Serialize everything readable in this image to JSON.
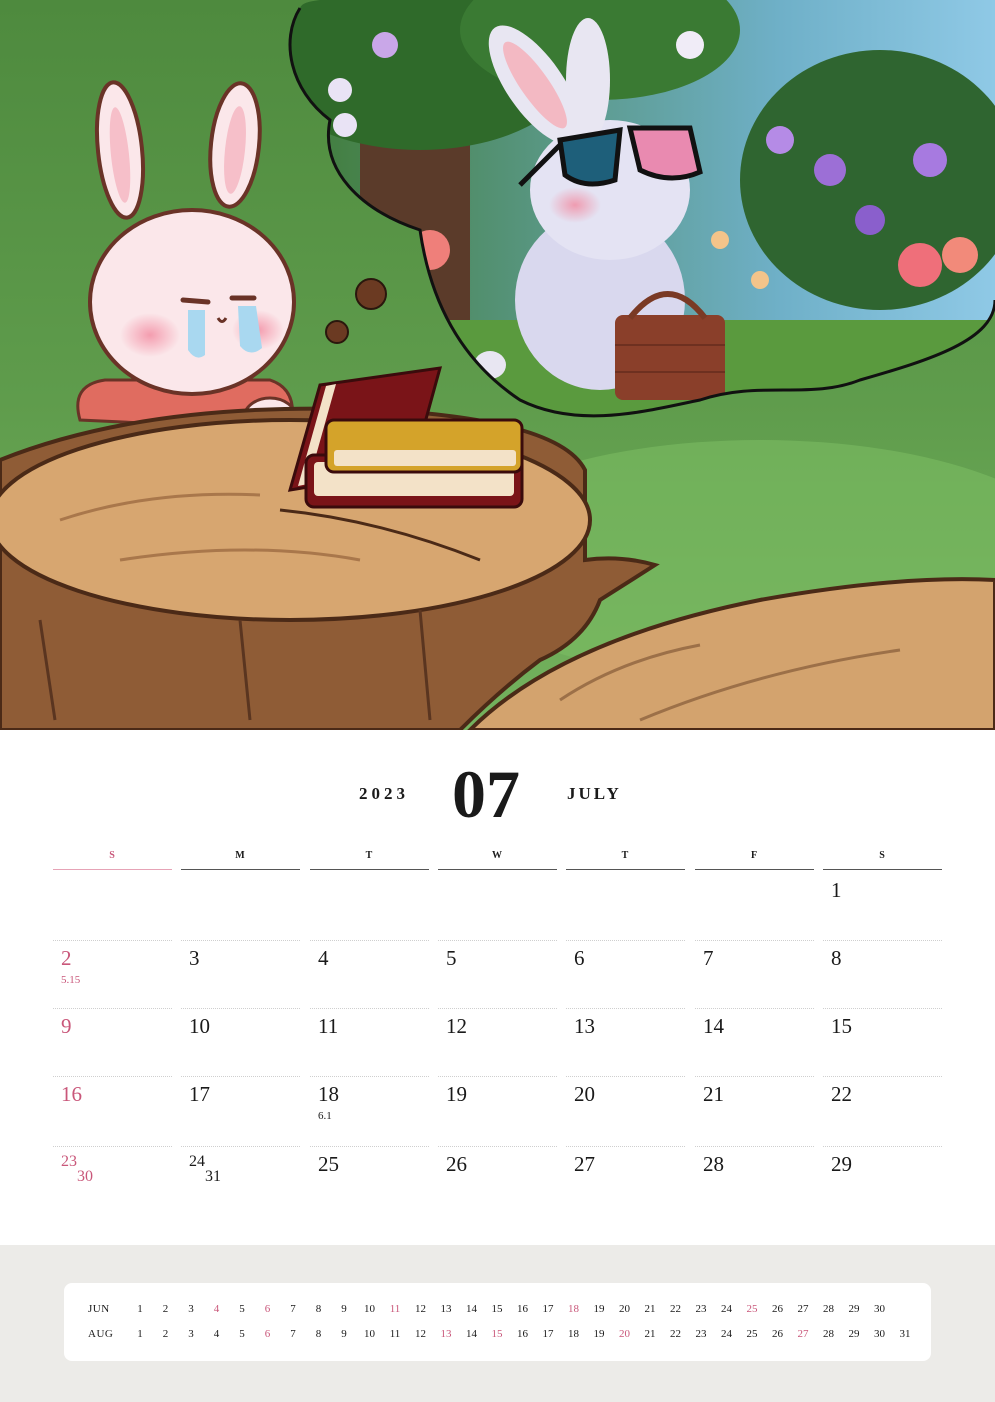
{
  "calendar": {
    "year": "2023",
    "month_number": "07",
    "month_name": "JULY"
  },
  "weekdays": [
    "S",
    "M",
    "T",
    "W",
    "T",
    "F",
    "S"
  ],
  "weeks": [
    [
      {
        "day": ""
      },
      {
        "day": ""
      },
      {
        "day": ""
      },
      {
        "day": ""
      },
      {
        "day": ""
      },
      {
        "day": ""
      },
      {
        "day": "1"
      }
    ],
    [
      {
        "day": "2",
        "sub": "5.15"
      },
      {
        "day": "3"
      },
      {
        "day": "4"
      },
      {
        "day": "5"
      },
      {
        "day": "6"
      },
      {
        "day": "7"
      },
      {
        "day": "8"
      }
    ],
    [
      {
        "day": "9"
      },
      {
        "day": "10"
      },
      {
        "day": "11"
      },
      {
        "day": "12"
      },
      {
        "day": "13"
      },
      {
        "day": "14"
      },
      {
        "day": "15"
      }
    ],
    [
      {
        "day": "16"
      },
      {
        "day": "17"
      },
      {
        "day": "18",
        "sub": "6.1"
      },
      {
        "day": "19"
      },
      {
        "day": "20"
      },
      {
        "day": "21"
      },
      {
        "day": "22"
      }
    ],
    [
      {
        "day": "23",
        "day2": "30"
      },
      {
        "day": "24",
        "day2": "31"
      },
      {
        "day": "25"
      },
      {
        "day": "26"
      },
      {
        "day": "27"
      },
      {
        "day": "28"
      },
      {
        "day": "29"
      }
    ]
  ],
  "mini_calendars": [
    {
      "label": "JUN",
      "days": [
        "1",
        "2",
        "3",
        "4",
        "5",
        "6",
        "7",
        "8",
        "9",
        "10",
        "11",
        "12",
        "13",
        "14",
        "15",
        "16",
        "17",
        "18",
        "19",
        "20",
        "21",
        "22",
        "23",
        "24",
        "25",
        "26",
        "27",
        "28",
        "29",
        "30"
      ],
      "red_days": [
        "4",
        "6",
        "11",
        "18",
        "25"
      ]
    },
    {
      "label": "AUG",
      "days": [
        "1",
        "2",
        "3",
        "4",
        "5",
        "6",
        "7",
        "8",
        "9",
        "10",
        "11",
        "12",
        "13",
        "14",
        "15",
        "16",
        "17",
        "18",
        "19",
        "20",
        "21",
        "22",
        "23",
        "24",
        "25",
        "26",
        "27",
        "28",
        "29",
        "30",
        "31"
      ],
      "red_days": [
        "6",
        "13",
        "15",
        "20",
        "27"
      ]
    }
  ],
  "colors": {
    "sunday_red": "#c9577a",
    "footer_bg": "#ecebe8"
  }
}
